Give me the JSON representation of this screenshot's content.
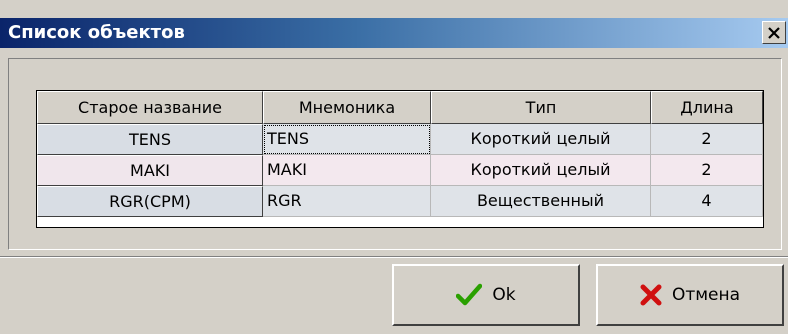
{
  "window": {
    "title": "Список объектов"
  },
  "icons": {
    "close": "close-icon",
    "ok": "checkmark-icon",
    "cancel": "cross-icon"
  },
  "colors": {
    "title_gradient_start": "#0a246a",
    "title_gradient_end": "#a6caf0",
    "ok_check": "#2aa000",
    "cancel_cross": "#d01010"
  },
  "table": {
    "columns": [
      "Старое название",
      "Мнемоника",
      "Тип",
      "Длина"
    ],
    "rows": [
      {
        "old_name": "TENS",
        "mnemonic": "TENS",
        "type": "Короткий целый",
        "length": "2"
      },
      {
        "old_name": "MAKI",
        "mnemonic": "MAKI",
        "type": "Короткий целый",
        "length": "2"
      },
      {
        "old_name": "RGR(CPM)",
        "mnemonic": "RGR",
        "type": "Вещественный",
        "length": "4"
      }
    ]
  },
  "buttons": {
    "ok_label": "Ok",
    "cancel_label": "Отмена"
  }
}
